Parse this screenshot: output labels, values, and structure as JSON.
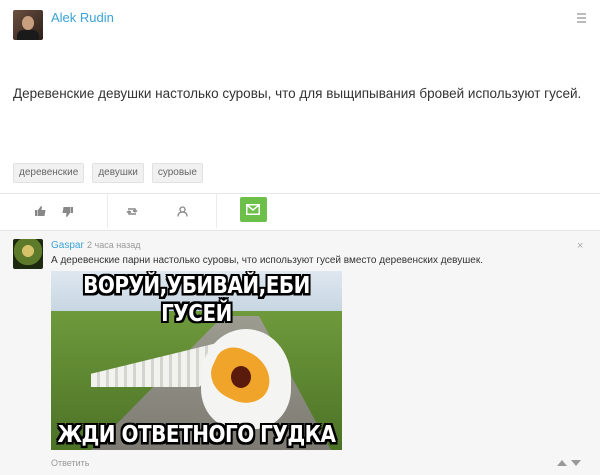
{
  "post": {
    "author": "Alek Rudin",
    "text": "Деревенские девушки настолько суровы, что для выщипывания бровей используют гусей.",
    "tags": [
      "деревенские",
      "девушки",
      "суровые"
    ]
  },
  "comment": {
    "author": "Gaspar",
    "time": "2 часа назад",
    "text": "А деревенские парни настолько суровы, что используют гусей вместо деревенских девушек.",
    "meme_top": "ВОРУЙ,УБИВАЙ,ЕБИ ГУСЕЙ",
    "meme_bottom": "ЖДИ ОТВЕТНОГО ГУДКА",
    "reply_label": "Ответить",
    "close_glyph": "×"
  },
  "colors": {
    "link": "#3aa3d8",
    "accent_green": "#6cc04a"
  },
  "icons": [
    "like-icon",
    "dislike-icon",
    "repost-icon",
    "subscribe-icon",
    "mail-icon",
    "menu-icon",
    "close-icon",
    "vote-up-icon",
    "vote-down-icon"
  ]
}
